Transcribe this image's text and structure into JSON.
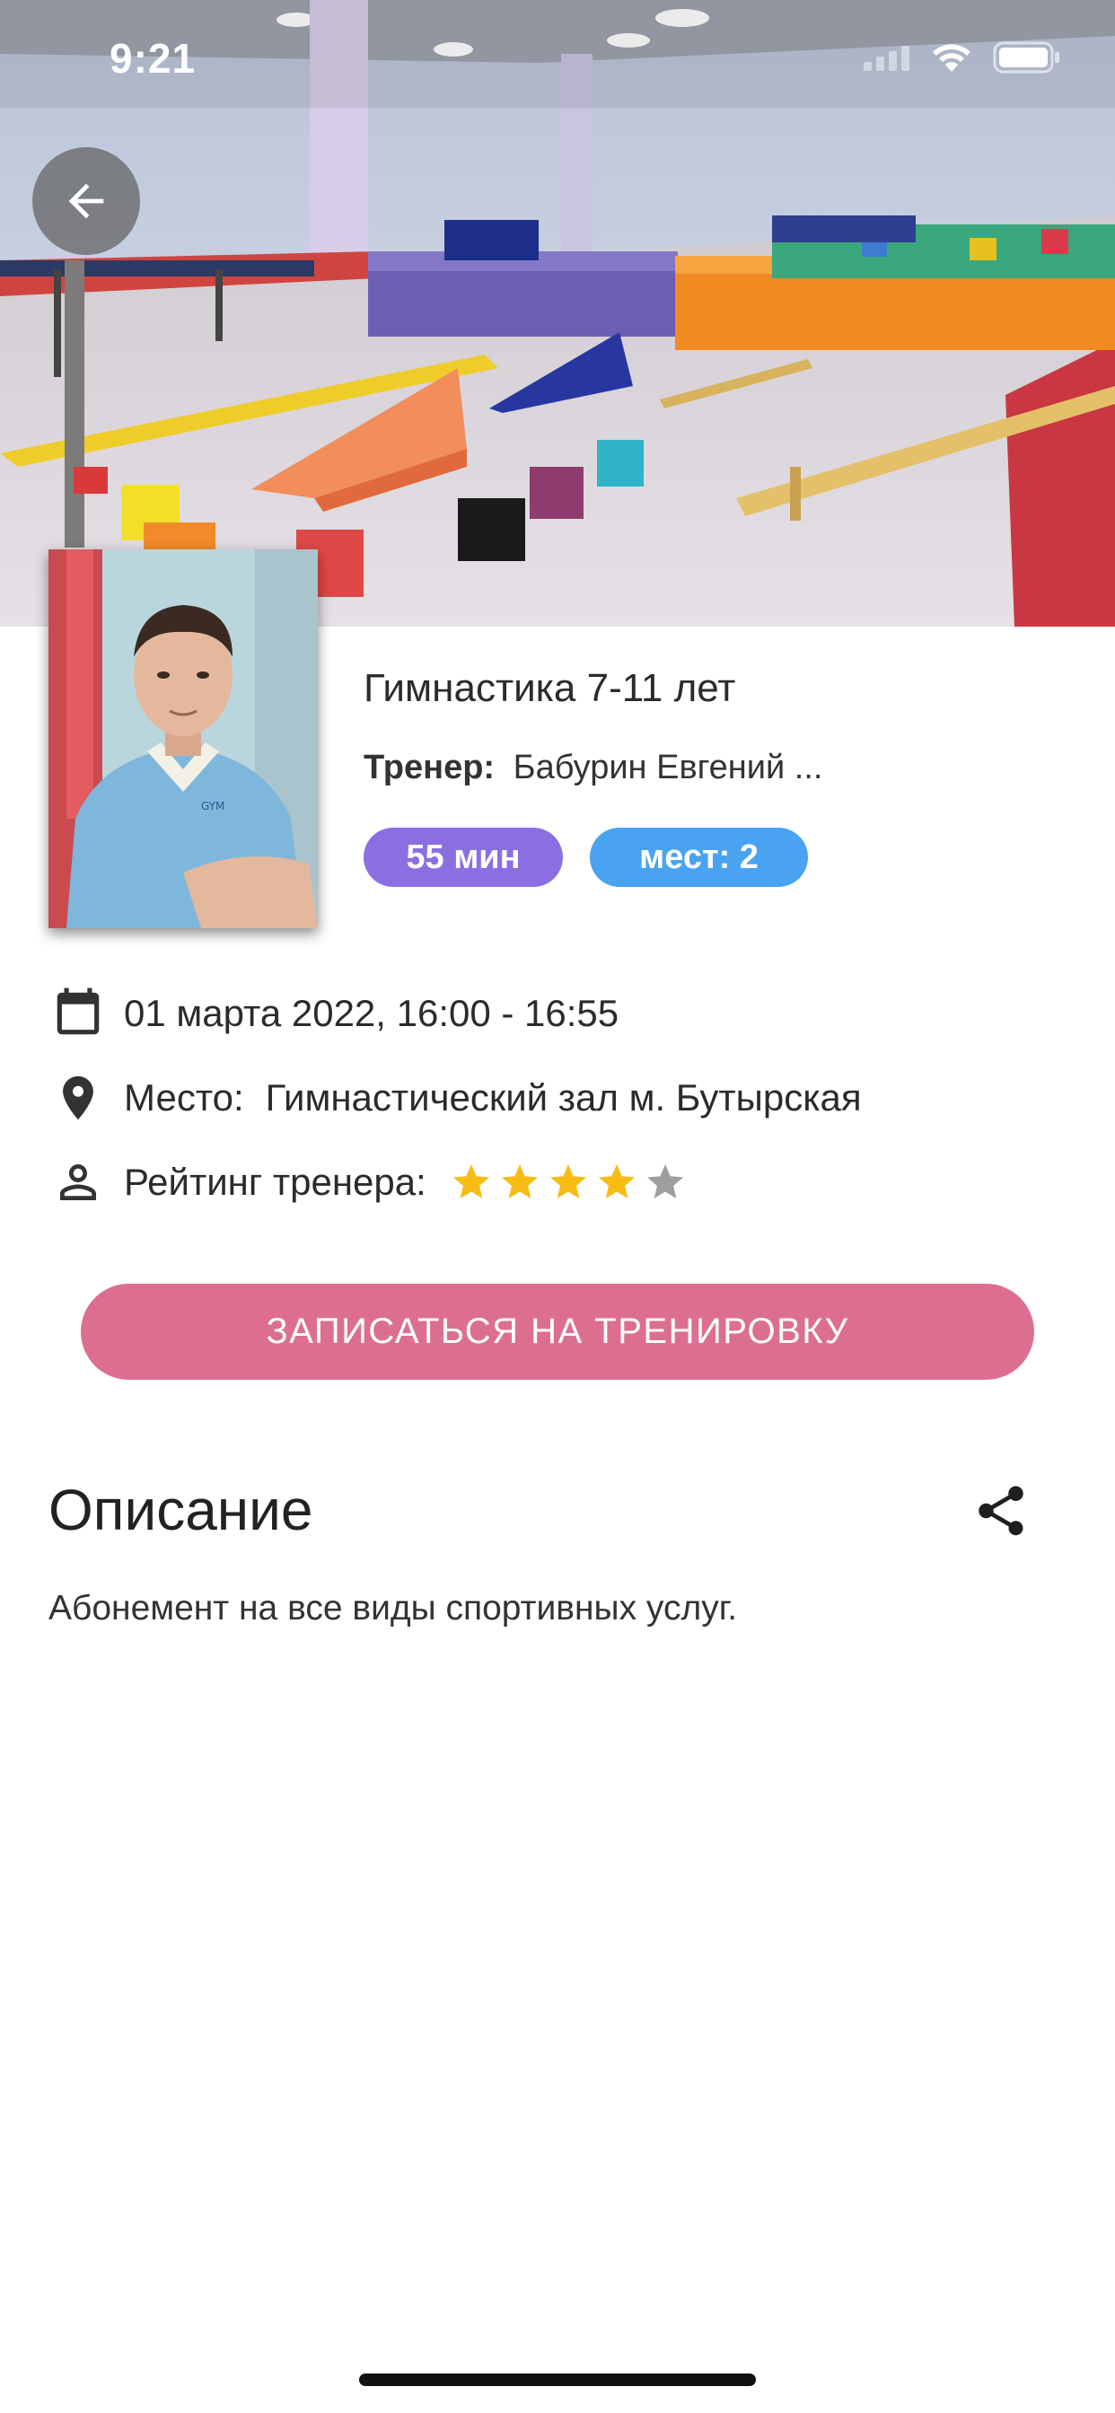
{
  "status_bar": {
    "time": "9:21"
  },
  "icons": {
    "back": "arrow-left-icon",
    "date": "calendar-icon",
    "place": "map-pin-icon",
    "rating": "person-icon",
    "share": "share-icon",
    "wifi": "wifi-icon",
    "battery": "battery-icon",
    "signal": "cellular-signal-icon"
  },
  "class_info": {
    "title": "Гимнастика 7-11 лет",
    "trainer_label": "Тренер:",
    "trainer_name": "Бабурин Евгений ...",
    "duration_badge": "55 мин",
    "seats_badge": "мест: 2"
  },
  "details": {
    "date_time": "01 марта 2022, 16:00 - 16:55",
    "place_label": "Место:",
    "place_value": "Гимнастический зал м. Бутырская",
    "rating_label": "Рейтинг тренера:",
    "rating_value": 4,
    "rating_max": 5
  },
  "actions": {
    "signup_label": "ЗАПИСАТЬСЯ НА ТРЕНИРОВКУ"
  },
  "description": {
    "heading": "Описание",
    "text": "Абонемент на все виды спортивных услуг."
  },
  "colors": {
    "accent_pink": "#dc6f8f",
    "badge_purple": "#8b6fe2",
    "badge_blue": "#4aa3f0",
    "star_filled": "#f6bd17",
    "star_empty": "#9e9e9e"
  }
}
